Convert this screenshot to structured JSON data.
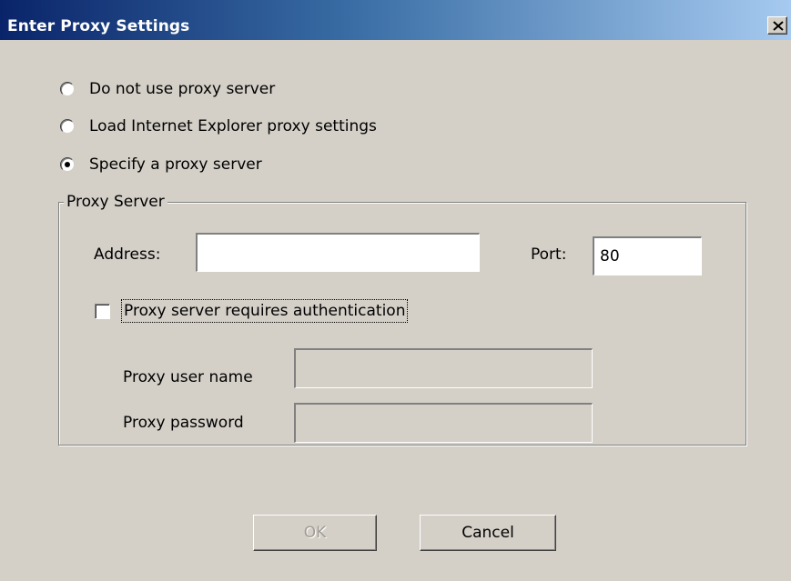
{
  "window": {
    "title": "Enter Proxy Settings"
  },
  "proxy_mode": {
    "options": [
      {
        "label": "Do not use proxy server",
        "selected": false
      },
      {
        "label": "Load Internet Explorer proxy settings",
        "selected": false
      },
      {
        "label": "Specify a proxy server",
        "selected": true
      }
    ]
  },
  "proxy_server": {
    "group_label": "Proxy Server",
    "address_label": "Address:",
    "address_value": "",
    "port_label": "Port:",
    "port_value": "80",
    "auth_label": "Proxy server requires authentication",
    "auth_checked": false,
    "username_label": "Proxy user name",
    "username_value": "",
    "password_label": "Proxy password",
    "password_value": ""
  },
  "buttons": {
    "ok_label": "OK",
    "ok_enabled": false,
    "cancel_label": "Cancel"
  }
}
